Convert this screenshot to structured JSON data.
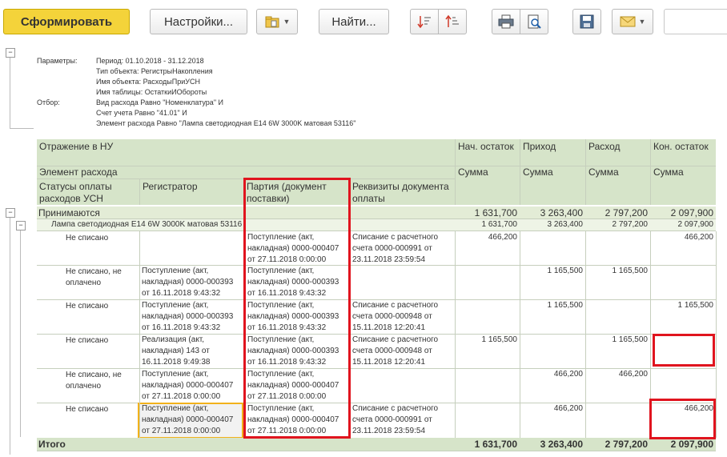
{
  "toolbar": {
    "generate_label": "Сформировать",
    "settings_label": "Настройки...",
    "find_label": "Найти..."
  },
  "params": {
    "params_label": "Параметры:",
    "period": "Период: 01.10.2018 - 31.12.2018",
    "object_type": "Тип объекта: РегистрыНакопления",
    "object_name": "Имя объекта: РасходыПриУСН",
    "table_name": "Имя таблицы: ОстаткиИОбороты",
    "filter_label": "Отбор:",
    "filter1": "Вид расхода Равно \"Номенклатура\" И",
    "filter2": "Счет учета Равно \"41.01\" И",
    "filter3": "Элемент расхода Равно \"Лампа светодиодная E14 6W 3000K матовая 53116\""
  },
  "header": {
    "reflection": "Отражение в НУ",
    "expense_element": "Элемент расхода",
    "statuses": "Статусы оплаты расходов УСН",
    "registrar": "Регистратор",
    "batch": "Партия (документ поставки)",
    "payment": "Реквизиты документа оплаты",
    "opening": "Нач. остаток",
    "income": "Приход",
    "expense": "Расход",
    "closing": "Кон. остаток",
    "sum": "Сумма"
  },
  "group": {
    "label": "Принимаются",
    "opening": "1 631,700",
    "income": "3 263,400",
    "expense": "2 797,200",
    "closing": "2 097,900"
  },
  "subgroup": {
    "label": "Лампа светодиодная E14 6W 3000K матовая 53116",
    "opening": "1 631,700",
    "income": "3 263,400",
    "expense": "2 797,200",
    "closing": "2 097,900"
  },
  "rows": [
    {
      "status": "Не списано",
      "registrar": "",
      "batch": "Поступление (акт, накладная) 0000-000407 от 27.11.2018 0:00:00",
      "payment": "Списание с расчетного счета 0000-000991 от 23.11.2018 23:59:54",
      "opening": "466,200",
      "income": "",
      "expense": "",
      "closing": "466,200"
    },
    {
      "status": "Не списано, не оплачено",
      "registrar": "Поступление (акт, накладная) 0000-000393 от 16.11.2018 9:43:32",
      "batch": "Поступление (акт, накладная) 0000-000393 от 16.11.2018 9:43:32",
      "payment": "",
      "opening": "",
      "income": "1 165,500",
      "expense": "1 165,500",
      "closing": ""
    },
    {
      "status": "Не списано",
      "registrar": "Поступление (акт, накладная) 0000-000393 от 16.11.2018 9:43:32",
      "batch": "Поступление (акт, накладная) 0000-000393 от 16.11.2018 9:43:32",
      "payment": "Списание с расчетного счета 0000-000948 от 15.11.2018 12:20:41",
      "opening": "",
      "income": "1 165,500",
      "expense": "",
      "closing": "1 165,500"
    },
    {
      "status": "Не списано",
      "registrar": "Реализация (акт, накладная) 143 от 16.11.2018 9:49:38",
      "batch": "Поступление (акт, накладная) 0000-000393 от 16.11.2018 9:43:32",
      "payment": "Списание с расчетного счета 0000-000948 от 15.11.2018 12:20:41",
      "opening": "1 165,500",
      "income": "",
      "expense": "1 165,500",
      "closing": ""
    },
    {
      "status": "Не списано, не оплачено",
      "registrar": "Поступление (акт, накладная) 0000-000407 от 27.11.2018 0:00:00",
      "batch": "Поступление (акт, накладная) 0000-000407 от 27.11.2018 0:00:00",
      "payment": "",
      "opening": "",
      "income": "466,200",
      "expense": "466,200",
      "closing": ""
    },
    {
      "status": "Не списано",
      "registrar": "Поступление (акт, накладная) 0000-000407 от 27.11.2018 0:00:00",
      "batch": "Поступление (акт, накладная) 0000-000407 от 27.11.2018 0:00:00",
      "payment": "Списание с расчетного счета 0000-000991 от 23.11.2018 23:59:54",
      "opening": "",
      "income": "466,200",
      "expense": "",
      "closing": "466,200"
    }
  ],
  "total": {
    "label": "Итого",
    "opening": "1 631,700",
    "income": "3 263,400",
    "expense": "2 797,200",
    "closing": "2 097,900"
  }
}
